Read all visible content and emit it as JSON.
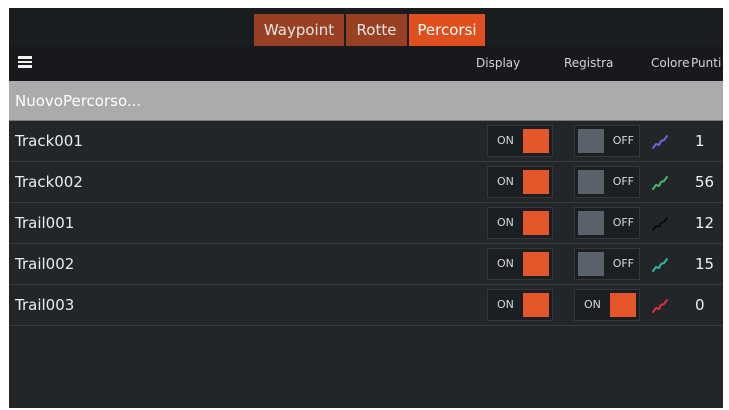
{
  "tabs": [
    {
      "label": "Waypoint",
      "active": false
    },
    {
      "label": "Rotte",
      "active": false
    },
    {
      "label": "Percorsi",
      "active": true
    }
  ],
  "header": {
    "menu_icon": "hamburger-menu-icon",
    "columns": {
      "display": "Display",
      "registra": "Registra",
      "colore": "Colore",
      "punti": "Punti"
    }
  },
  "new_track_label": "NuovoPercorso...",
  "colors": {
    "accent": "#e0501e",
    "toggle_on": "#e5572a",
    "toggle_off": "#59626b"
  },
  "tracks": [
    {
      "name": "Track001",
      "display": "ON",
      "registra": "OFF",
      "color": "#6a63e0",
      "punti": "1"
    },
    {
      "name": "Track002",
      "display": "ON",
      "registra": "OFF",
      "color": "#3fb85f",
      "punti": "56"
    },
    {
      "name": "Trail001",
      "display": "ON",
      "registra": "OFF",
      "color": "#0b0b0b",
      "punti": "12"
    },
    {
      "name": "Trail002",
      "display": "ON",
      "registra": "OFF",
      "color": "#2bb5a0",
      "punti": "15"
    },
    {
      "name": "Trail003",
      "display": "ON",
      "registra": "ON",
      "color": "#d9323a",
      "punti": "0"
    }
  ]
}
